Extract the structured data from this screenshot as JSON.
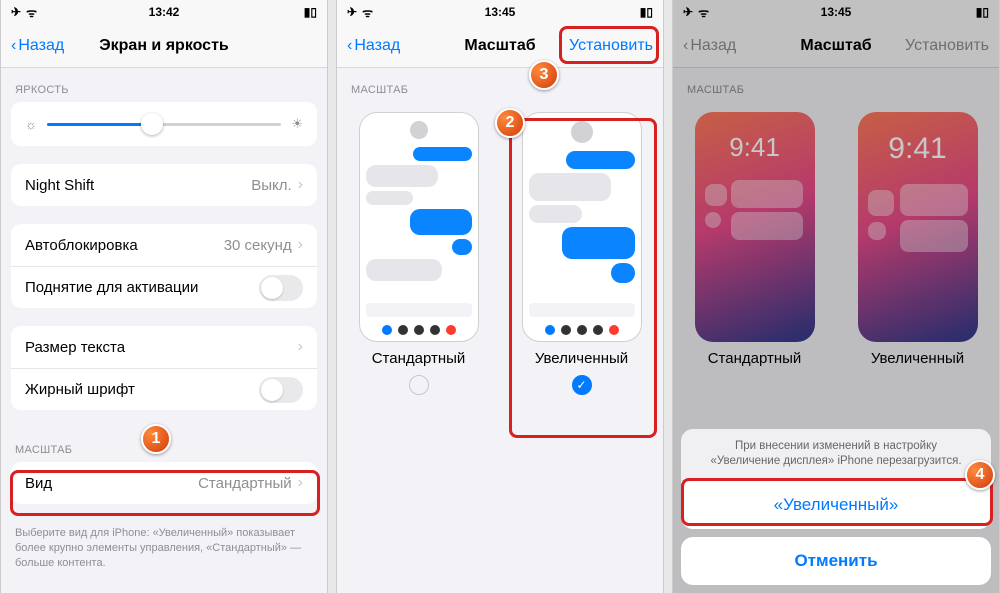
{
  "status": {
    "time1": "13:42",
    "time2": "13:45",
    "time3": "13:45",
    "airplane": "✈",
    "wifi": "📶",
    "battery": "▮▯"
  },
  "s1": {
    "back": "Назад",
    "title": "Экран и яркость",
    "sec_brightness": "ЯРКОСТЬ",
    "sec_zoom": "МАСШТАБ",
    "night_shift": "Night Shift",
    "night_shift_val": "Выкл.",
    "autolock": "Автоблокировка",
    "autolock_val": "30 секунд",
    "raise": "Поднятие для активации",
    "text_size": "Размер текста",
    "bold": "Жирный шрифт",
    "view": "Вид",
    "view_val": "Стандартный",
    "view_note": "Выберите вид для iPhone: «Увеличенный» показывает более крупно элементы управления, «Стандартный» — больше контента.",
    "brightness_pct": 45
  },
  "s2": {
    "back": "Назад",
    "title": "Масштаб",
    "action": "Установить",
    "sec": "МАСШТАБ",
    "opt_std": "Стандартный",
    "opt_zoom": "Увеличенный"
  },
  "s3": {
    "back": "Назад",
    "title": "Масштаб",
    "action": "Установить",
    "sec": "МАСШТАБ",
    "opt_std": "Стандартный",
    "opt_zoom": "Увеличенный",
    "lock_time": "9:41",
    "sheet_note": "При внесении изменений в настройку «Увеличение дисплея» iPhone перезагрузится.",
    "confirm": "«Увеличенный»",
    "cancel": "Отменить"
  },
  "badges": {
    "b1": "1",
    "b2": "2",
    "b3": "3",
    "b4": "4"
  }
}
